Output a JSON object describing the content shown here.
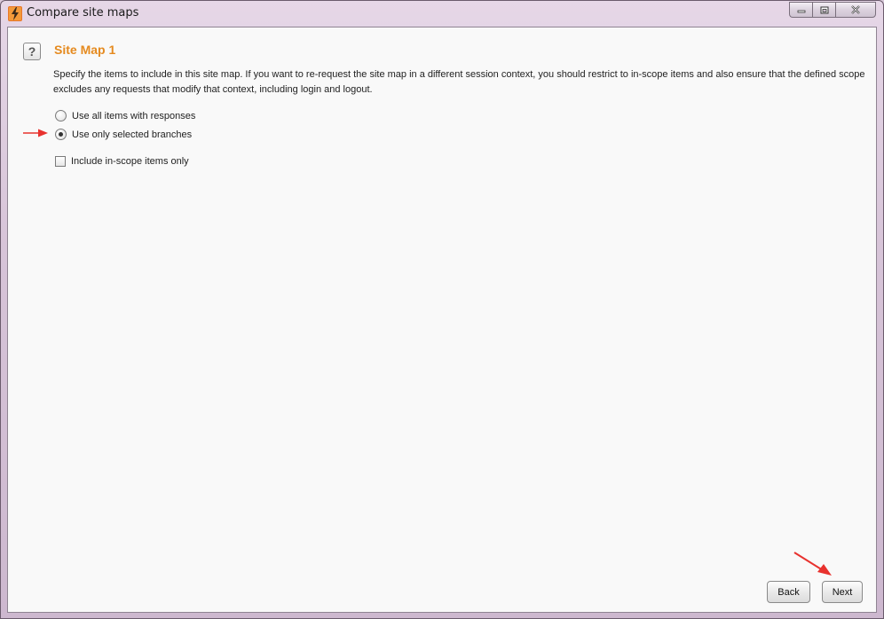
{
  "window": {
    "title": "Compare site maps",
    "accent_color": "#e58a1f",
    "annotation_color": "#e8322e"
  },
  "panel": {
    "heading": "Site Map 1",
    "help_glyph": "?",
    "description": "Specify the items to include in this site map. If you want to re-request the site map in a different session context, you should restrict to in-scope items and also ensure that the defined scope excludes any requests that modify that context, including login and logout."
  },
  "options": {
    "all_items": {
      "label": "Use all items with responses",
      "checked": false
    },
    "selected_branches": {
      "label": "Use only selected branches",
      "checked": true
    },
    "in_scope_only": {
      "label": "Include in-scope items only",
      "checked": false
    }
  },
  "buttons": {
    "back": "Back",
    "next": "Next"
  },
  "icons": {
    "app": "burp-lightning-icon",
    "help": "help-icon",
    "minimize": "minimize-icon",
    "maximize": "restore-icon",
    "close": "close-icon"
  }
}
